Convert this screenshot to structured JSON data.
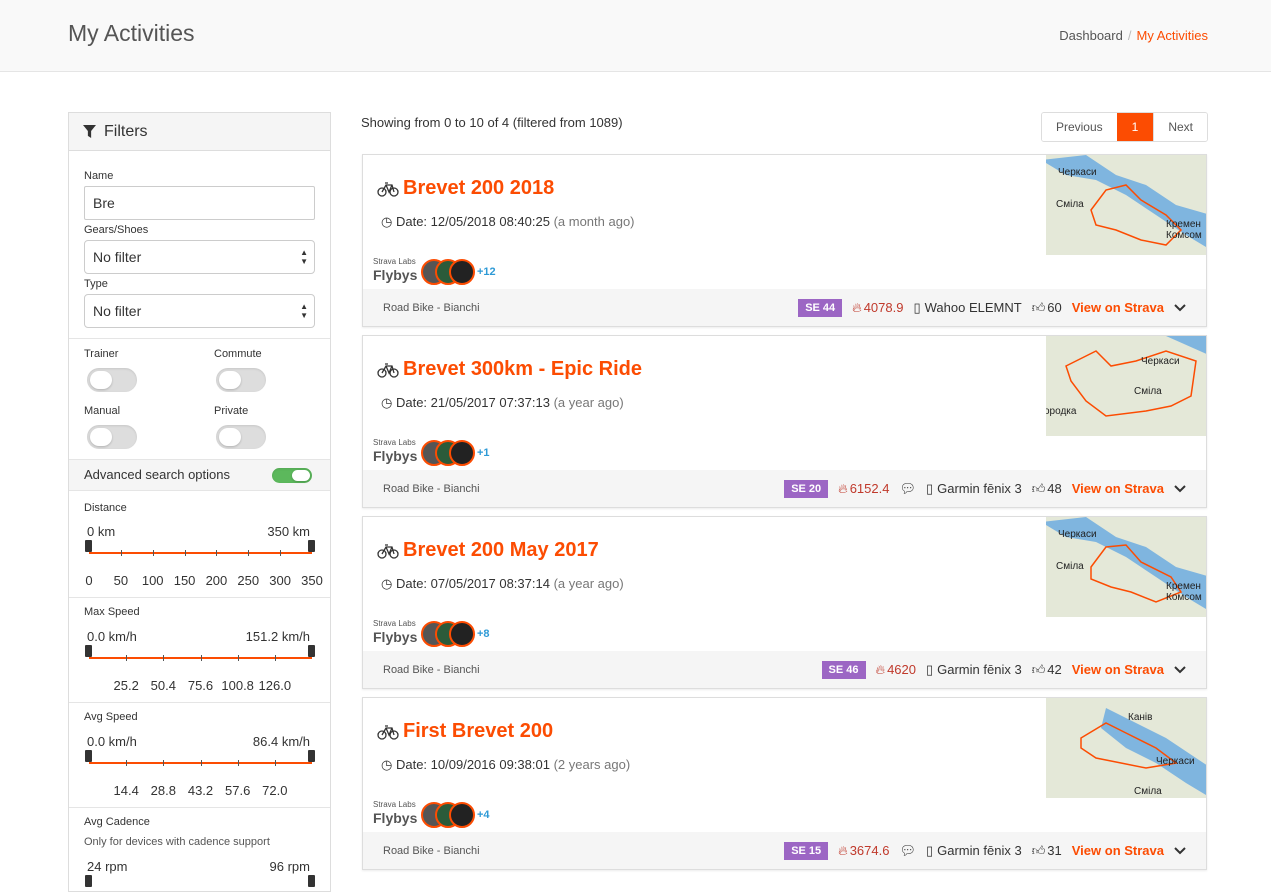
{
  "page": {
    "title": "My Activities"
  },
  "breadcrumb": {
    "items": [
      "Dashboard",
      "My Activities"
    ]
  },
  "filters": {
    "heading": "Filters",
    "name_label": "Name",
    "name_value": "Bre",
    "gears_label": "Gears/Shoes",
    "gears_value": "No filter",
    "type_label": "Type",
    "type_value": "No filter",
    "trainer_label": "Trainer",
    "commute_label": "Commute",
    "manual_label": "Manual",
    "private_label": "Private",
    "advanced_label": "Advanced search options",
    "advanced_on": true,
    "distance": {
      "label": "Distance",
      "min": "0 km",
      "max": "350 km",
      "axis": [
        "0",
        "50",
        "100",
        "150",
        "200",
        "250",
        "300",
        "350"
      ]
    },
    "max_speed": {
      "label": "Max Speed",
      "min": "0.0 km/h",
      "max": "151.2 km/h",
      "axis": [
        "25.2",
        "50.4",
        "75.6",
        "100.8",
        "126.0"
      ]
    },
    "avg_speed": {
      "label": "Avg Speed",
      "min": "0.0 km/h",
      "max": "86.4 km/h",
      "axis": [
        "14.4",
        "28.8",
        "43.2",
        "57.6",
        "72.0"
      ]
    },
    "avg_cadence": {
      "label": "Avg Cadence",
      "note": "Only for devices with cadence support",
      "min": "24 rpm",
      "max": "96 rpm"
    }
  },
  "results": {
    "showing": "Showing from 0 to 10 of 4 (filtered from 1089)",
    "pager": {
      "prev": "Previous",
      "current": "1",
      "next": "Next"
    }
  },
  "flybys_small": "Strava Labs",
  "flybys_big": "Flybys",
  "view_label": "View on Strava",
  "date_prefix": "Date:",
  "activities": [
    {
      "title": "Brevet 200 2018",
      "date": "12/05/2018 08:40:25",
      "ago": "(a month ago)",
      "flyby_plus": "+12",
      "gear": "Road Bike - Bianchi",
      "se": "SE 44",
      "suffer": "4078.9",
      "device": "Wahoo ELEMNT",
      "kudos": "60",
      "comments": false,
      "map_labels": [
        "Черкаси",
        "Сміла",
        "Кремен",
        "Комсом"
      ]
    },
    {
      "title": "Brevet 300km - Epic Ride",
      "date": "21/05/2017 07:37:13",
      "ago": "(a year ago)",
      "flyby_plus": "+1",
      "gear": "Road Bike - Bianchi",
      "se": "SE 20",
      "suffer": "6152.4",
      "device": "Garmin fēnix 3",
      "kudos": "48",
      "comments": true,
      "map_labels": [
        "Черкаси",
        "Сміла",
        "ородка"
      ]
    },
    {
      "title": "Brevet 200 May 2017",
      "date": "07/05/2017 08:37:14",
      "ago": "(a year ago)",
      "flyby_plus": "+8",
      "gear": "Road Bike - Bianchi",
      "se": "SE 46",
      "suffer": "4620",
      "device": "Garmin fēnix 3",
      "kudos": "42",
      "comments": false,
      "map_labels": [
        "Черкаси",
        "Сміла",
        "Кремен",
        "Комсом"
      ]
    },
    {
      "title": "First Brevet 200",
      "date": "10/09/2016 09:38:01",
      "ago": "(2 years ago)",
      "flyby_plus": "+4",
      "gear": "Road Bike - Bianchi",
      "se": "SE 15",
      "suffer": "3674.6",
      "device": "Garmin fēnix 3",
      "kudos": "31",
      "comments": true,
      "map_labels": [
        "Канів",
        "Черкаси",
        "Сміла"
      ]
    }
  ],
  "colors": {
    "accent": "#fc4c02",
    "se_badge": "#9c66c4",
    "suffer": "#c0392b",
    "toggle_on": "#5cb85c",
    "flyby_plus": "#2e9ad6"
  },
  "icons": [
    "filter-icon",
    "bike-icon",
    "clock-icon",
    "flame-icon",
    "comment-icon",
    "device-icon",
    "thumbs-up-icon",
    "chevron-down-icon",
    "select-arrows-icon"
  ]
}
